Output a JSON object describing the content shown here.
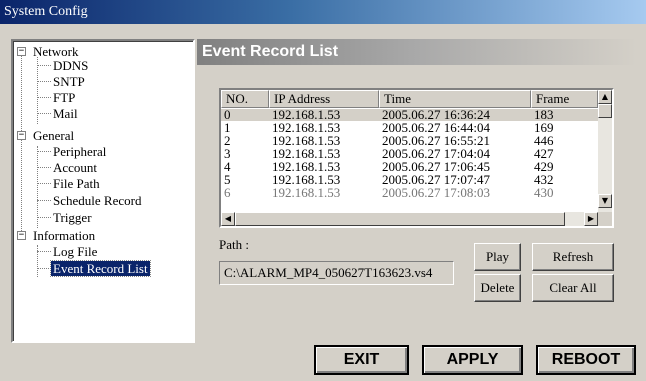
{
  "window": {
    "title": "System Config"
  },
  "tree": {
    "groups": [
      {
        "label": "Network",
        "expander": "−",
        "children": [
          "DDNS",
          "SNTP",
          "FTP",
          "Mail"
        ]
      },
      {
        "label": "General",
        "expander": "−",
        "children": [
          "Peripheral",
          "Account",
          "File Path",
          "Schedule Record",
          "Trigger"
        ]
      },
      {
        "label": "Information",
        "expander": "−",
        "children": [
          "Log File",
          "Event Record List"
        ]
      }
    ],
    "selected": "Event Record List"
  },
  "section": {
    "title": "Event Record List"
  },
  "list": {
    "columns": [
      "NO.",
      "IP Address",
      "Time",
      "Frame"
    ],
    "rows": [
      [
        "0",
        "192.168.1.53",
        "2005.06.27 16:36:24",
        "183"
      ],
      [
        "1",
        "192.168.1.53",
        "2005.06.27 16:44:04",
        "169"
      ],
      [
        "2",
        "192.168.1.53",
        "2005.06.27 16:55:21",
        "446"
      ],
      [
        "3",
        "192.168.1.53",
        "2005.06.27 17:04:04",
        "427"
      ],
      [
        "4",
        "192.168.1.53",
        "2005.06.27 17:06:45",
        "429"
      ],
      [
        "5",
        "192.168.1.53",
        "2005.06.27 17:07:47",
        "432"
      ],
      [
        "6",
        "192.168.1.53",
        "2005.06.27 17:08:03",
        "430"
      ]
    ],
    "selected_row": 0,
    "scroll_up": "▲",
    "scroll_down": "▼",
    "scroll_left": "◀",
    "scroll_right": "▶"
  },
  "path": {
    "label": "Path :",
    "value": "C:\\ALARM_MP4_050627T163623.vs4"
  },
  "buttons": {
    "play": "Play",
    "refresh": "Refresh",
    "delete": "Delete",
    "clear_all": "Clear All",
    "exit": "EXIT",
    "apply": "APPLY",
    "reboot": "REBOOT"
  },
  "colors": {
    "title_gradient_start": "#0a246a",
    "selection": "#0a246a",
    "face": "#d4d0c8"
  }
}
